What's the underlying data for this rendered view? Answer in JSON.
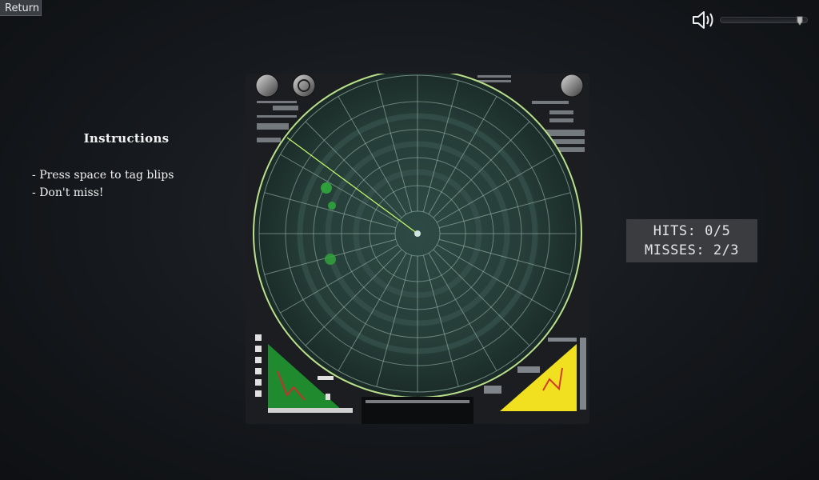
{
  "return_label": "Return",
  "sound": {
    "icon": "speaker-icon",
    "volume": 0.95
  },
  "instructions": {
    "title": "Instructions",
    "items": [
      "Press space to tag blips",
      "Don't miss!"
    ]
  },
  "score": {
    "hits_text": "HITS: 0/5",
    "misses_text": "MISSES: 2/3"
  },
  "colors": {
    "radar_ring": "#b9e08a",
    "sweep": "#c8ff6a",
    "blip": "#2fa83a",
    "panel_green": "#1f8a2e",
    "panel_yellow": "#f0e020"
  }
}
